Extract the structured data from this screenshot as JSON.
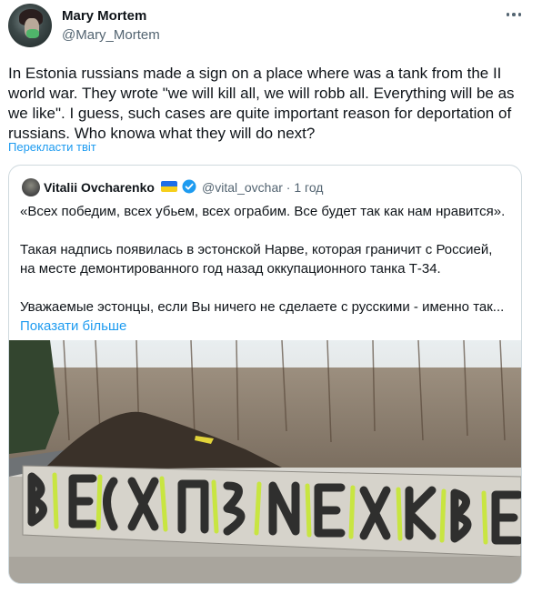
{
  "author": {
    "name": "Mary Mortem",
    "handle": "@Mary_Mortem"
  },
  "tweet": {
    "text": "In Estonia russians made a sign on a place where was a tank from the II world war. They wrote \"we will kill all, we will robb all. Everything will be as we like\". I guess, such cases are quite important reason for deportation of russians. Who knowa what they will do next?",
    "translate_label": "Перекласти твіт"
  },
  "quote": {
    "name": "Vitalii Ovcharenko",
    "handle_time": "@vital_ovchar · 1 год",
    "paragraph1": "«Всех победим, всех убьем, всех ограбим. Все будет так как нам нравится».",
    "paragraph2": "Такая надпись появилась в эстонской Нарве, которая граничит с Россией, на месте демонтированного год назад оккупационного танка Т-34.",
    "paragraph3": "Уважаемые эстонцы, если Вы ничего не сделаете с русскими - именно так...",
    "show_more": "Показати більше"
  },
  "colors": {
    "link": "#1d9bf0",
    "secondary_text": "#536471",
    "flag_blue": "#1e6ee8",
    "flag_yellow": "#f6cf1b",
    "graffiti": "#c8e63a"
  },
  "icons": [
    "more-icon",
    "ukraine-flag-icon",
    "verified-badge-icon"
  ]
}
